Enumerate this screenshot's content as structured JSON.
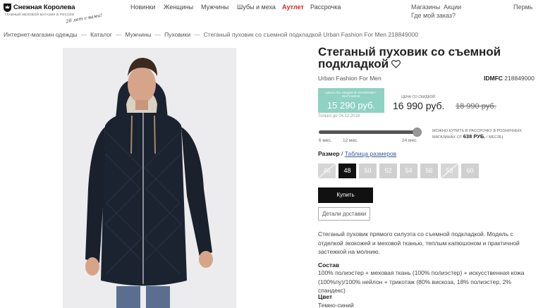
{
  "header": {
    "logo_name": "Снежная Королева",
    "logo_tagline": "главный меховой магазин в России",
    "logo_script": "20 лет с вами!",
    "nav": [
      "Новинки",
      "Женщины",
      "Мужчины",
      "Шубы и меха",
      "Аутлет",
      "Рассрочка"
    ],
    "stores": "Магазины",
    "promos": "Акции",
    "where_order": "Где мой заказ?",
    "city": "Пермь"
  },
  "breadcrumb": [
    "Интернет-магазин одежды",
    "Каталог",
    "Мужчины",
    "Пуховики",
    "Стеганый пуховик со съемной подкладкой Urban Fashion For Men 218849000"
  ],
  "product": {
    "title": "Стеганый пуховик со съемной подкладкой",
    "brand": "Urban Fashion For Men",
    "sku_label": "IDMFC",
    "sku_value": "218849000",
    "promo_label": "цена по акции в интернет-магазине",
    "promo_price": "15 290 руб.",
    "promo_until": "Только до 04.12.2018",
    "discount_label": "цена со скидкой",
    "discount_price": "16 990 руб.",
    "old_price": "18 990 руб.",
    "installment": {
      "ticks": [
        "6 мес.",
        "12 мес.",
        "24 мес."
      ],
      "selected_fraction": 1.0,
      "note_before": "можно купить в рассрочку в розничных магазинах от",
      "amount": "638 руб.",
      "note_after": "/ месяц"
    },
    "size_label": "Размер",
    "size_table": "Таблица размеров",
    "sizes": [
      {
        "label": "46",
        "state": "unavailable"
      },
      {
        "label": "48",
        "state": "selected"
      },
      {
        "label": "50",
        "state": "available"
      },
      {
        "label": "52",
        "state": "available"
      },
      {
        "label": "54",
        "state": "available"
      },
      {
        "label": "56",
        "state": "available"
      },
      {
        "label": "58",
        "state": "unavailable"
      },
      {
        "label": "60",
        "state": "available"
      }
    ],
    "buy_label": "Купить",
    "delivery_label": "Детали доставки",
    "description": "Стеганый пуховик прямого силуэта со съемной подкладкой. Модель с отделкой экокожей и меховой тканью, теплым капюшоном и практичной застежкой на молнию.",
    "composition_heading": "Состав",
    "composition": "100% полиэстер + меховая ткань (100% полиэстер) + искусственная кожа (100%пу)/100% нейлон + трикотаж (80% вискоза, 18% полиэстер, 2% спандекс)",
    "color_heading": "Цвет",
    "color": "Темно-синий"
  },
  "colors": {
    "promo_bg": "#8fd1c3",
    "outlet": "#dd2222",
    "buy_bg": "#111111",
    "link": "#3a5a9a"
  }
}
